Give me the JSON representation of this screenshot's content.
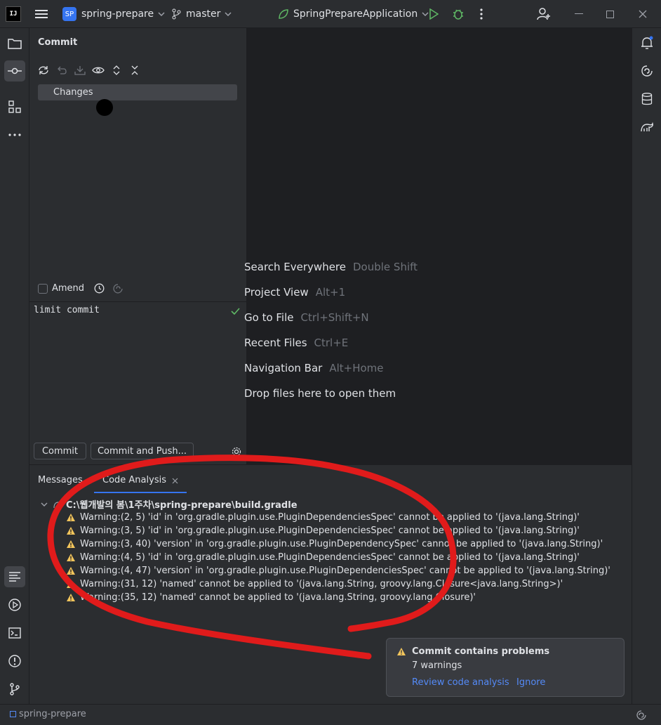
{
  "titlebar": {
    "logo_text": "IJ",
    "project_badge": "SP",
    "project_name": "spring-prepare",
    "branch": "master",
    "run_config": "SpringPrepareApplication"
  },
  "commit_panel": {
    "title": "Commit",
    "changes_label": "Changes",
    "amend_label": "Amend",
    "commit_message": "limit commit",
    "commit_button": "Commit",
    "commit_push_button": "Commit and Push..."
  },
  "editor_hints": [
    {
      "action": "Search Everywhere",
      "key": "Double Shift"
    },
    {
      "action": "Project View",
      "key": "Alt+1"
    },
    {
      "action": "Go to File",
      "key": "Ctrl+Shift+N"
    },
    {
      "action": "Recent Files",
      "key": "Ctrl+E"
    },
    {
      "action": "Navigation Bar",
      "key": "Alt+Home"
    },
    {
      "action": "Drop files here to open them",
      "key": ""
    }
  ],
  "bottom_panel": {
    "tabs": [
      "Messages",
      "Code Analysis"
    ],
    "file_path": "C:\\웹개발의 봄\\1주차\\spring-prepare\\build.gradle",
    "warnings": [
      "Warning:(2, 5)  'id' in 'org.gradle.plugin.use.PluginDependenciesSpec' cannot be applied to '(java.lang.String)'",
      "Warning:(3, 5)  'id' in 'org.gradle.plugin.use.PluginDependenciesSpec' cannot be applied to '(java.lang.String)'",
      "Warning:(3, 40)  'version' in 'org.gradle.plugin.use.PluginDependencySpec' cannot be applied to '(java.lang.String)'",
      "Warning:(4, 5)  'id' in 'org.gradle.plugin.use.PluginDependenciesSpec' cannot be applied to '(java.lang.String)'",
      "Warning:(4, 47)  'version' in 'org.gradle.plugin.use.PluginDependenciesSpec' cannot be applied to '(java.lang.String)'",
      "Warning:(31, 12)  'named' cannot be applied to '(java.lang.String, groovy.lang.Closure<java.lang.String>)'",
      "Warning:(35, 12)  'named' cannot be applied to '(java.lang.String, groovy.lang.Closure)'"
    ]
  },
  "notification": {
    "title": "Commit contains problems",
    "subtitle": "7 warnings",
    "link_review": "Review code analysis",
    "link_ignore": "Ignore"
  },
  "statusbar": {
    "project": "spring-prepare"
  },
  "colors": {
    "accent": "#3574f0",
    "warning": "#f2c55c",
    "annotation": "#e01b1b",
    "link": "#548af7"
  }
}
